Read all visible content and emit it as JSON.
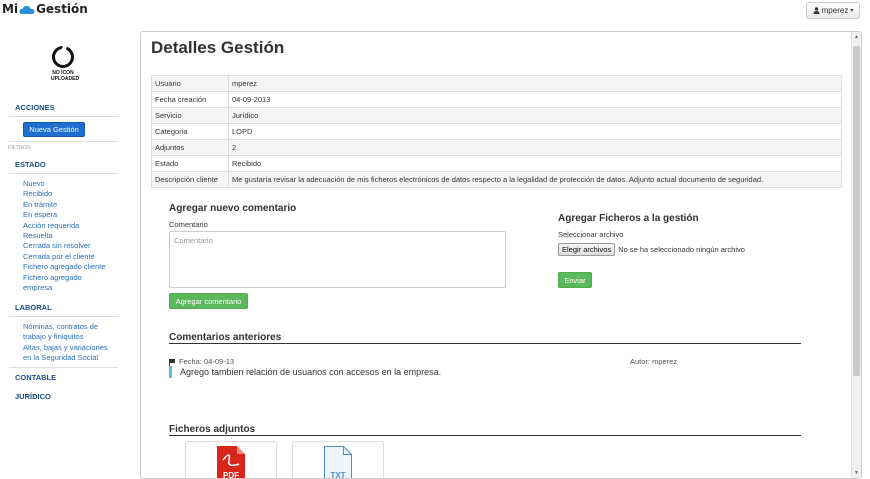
{
  "app": {
    "logo_left": "Mi",
    "logo_right": "Gestión"
  },
  "user": {
    "name": "mperez",
    "icon": "user-icon",
    "caret": "▾"
  },
  "sidebar": {
    "noicon": {
      "line1": "NO ICON",
      "line2": "UPLOADED"
    },
    "acciones": "ACCIONES",
    "nueva_gestion": "Nueva Gestión",
    "filtros": "FILTROS",
    "estado": "ESTADO",
    "estado_items": [
      "Nuevo",
      "Recibido",
      "En trámite",
      "En espera",
      "Acción requerida",
      "Resuelta",
      "Cerrada sin resolver",
      "Cerrada por el cliente",
      "Fichero agregado cliente",
      "Fichero agregado",
      "empresa"
    ],
    "laboral": "LABORAL",
    "laboral_items": [
      "Nóminas, contratos de",
      "trabajo y finiquitos",
      "Altas, bajas y variaciones",
      "en la Seguridad Social"
    ],
    "contable": "CONTABLE",
    "juridico": "JURÍDICO"
  },
  "main": {
    "title": "Detalles Gestión",
    "details": [
      {
        "key": "Usuario",
        "value": "mperez"
      },
      {
        "key": "Fecha creación",
        "value": "04-09-2013"
      },
      {
        "key": "Servicio",
        "value": "Jurídico"
      },
      {
        "key": "Categoria",
        "value": "LOPD"
      },
      {
        "key": "Adjuntos",
        "value": "2"
      },
      {
        "key": "Estado",
        "value": "Recibido"
      },
      {
        "key": "Descripción cliente",
        "value": "Me gustaría revisar la adecuación de mis ficheros electrónicos de datos respecto a la legalidad de protección de datos. Adjunto actual documento de seguridad."
      }
    ],
    "add_comment": {
      "heading": "Agregar nuevo comentario",
      "label": "Comentario",
      "placeholder": "Comentario",
      "button": "Agregar comentario"
    },
    "add_files": {
      "heading": "Agregar Ficheros a la gestión",
      "label": "Seleccionar archivo",
      "choose_button": "Elegir archivos",
      "no_file": "No se ha seleccionado ningún archivo",
      "send_button": "Enviar"
    },
    "previous": {
      "heading": "Comentarios anteriores",
      "comments": [
        {
          "date": "Fecha: 04-09-13",
          "author": "Autor: mperez",
          "text": "Agrego tambien relación de usuarios con accesos en la empresa."
        }
      ]
    },
    "attachments": {
      "heading": "Ficheros adjuntos",
      "files": [
        {
          "type": "PDF",
          "color": "#d9261c"
        },
        {
          "type": "TXT",
          "color": "#4a8cc9"
        }
      ]
    }
  },
  "colors": {
    "primary": "#1e6fd0",
    "success": "#5cb85c",
    "link": "#2a6fba",
    "accent": "#5bc0de"
  }
}
